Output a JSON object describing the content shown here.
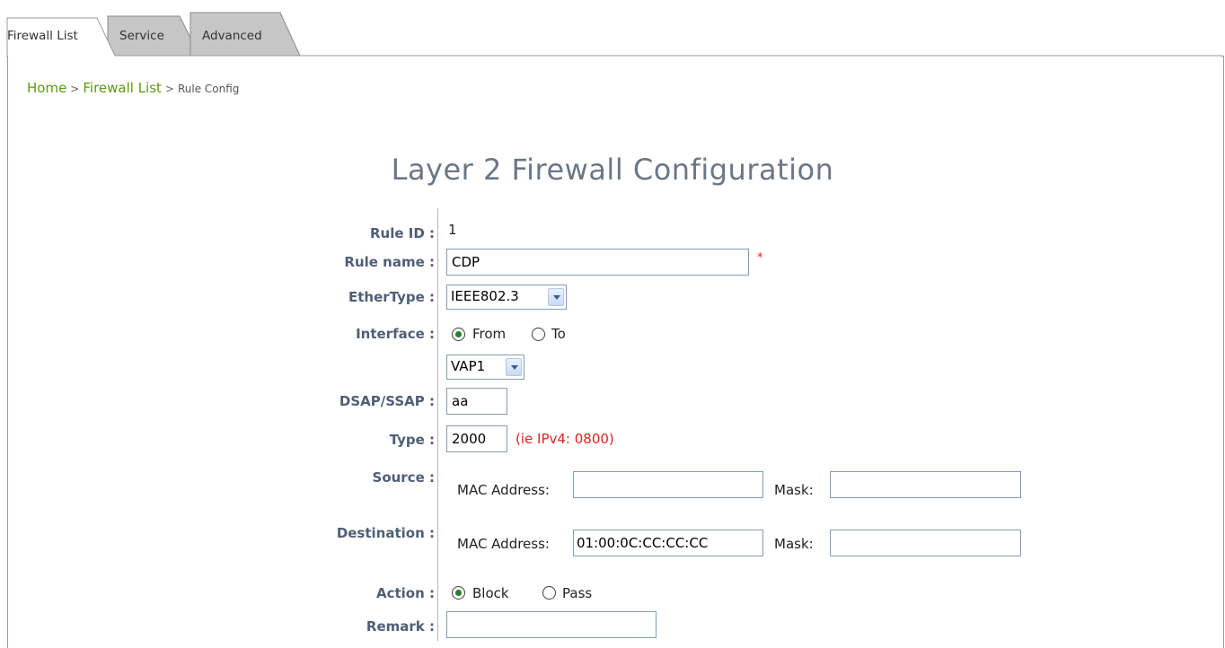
{
  "tabs": [
    {
      "label": "Firewall List",
      "active": true
    },
    {
      "label": "Service",
      "active": false
    },
    {
      "label": "Advanced",
      "active": false
    }
  ],
  "breadcrumb": {
    "home": "Home",
    "sep1": ">",
    "firewall_list": "Firewall List",
    "sep2": ">",
    "current": "Rule Config"
  },
  "page_title": "Layer 2 Firewall Configuration",
  "form": {
    "rule_id": {
      "label": "Rule ID :",
      "value": "1"
    },
    "rule_name": {
      "label": "Rule name :",
      "value": "CDP",
      "required_mark": "*"
    },
    "ethertype": {
      "label": "EtherType :",
      "selected": "IEEE802.3"
    },
    "interface": {
      "label": "Interface :",
      "from_label": "From",
      "to_label": "To",
      "selected_direction": "From",
      "selected": "VAP1"
    },
    "dsap_ssap": {
      "label": "DSAP/SSAP :",
      "value": "aa"
    },
    "type": {
      "label": "Type :",
      "value": "2000",
      "hint": "(ie IPv4: 0800)"
    },
    "source": {
      "label": "Source :",
      "mac_label": "MAC Address:",
      "mac_value": "",
      "mask_label": "Mask:",
      "mask_value": ""
    },
    "destination": {
      "label": "Destination :",
      "mac_label": "MAC Address:",
      "mac_value": "01:00:0C:CC:CC:CC",
      "mask_label": "Mask:",
      "mask_value": ""
    },
    "action": {
      "label": "Action :",
      "block_label": "Block",
      "pass_label": "Pass",
      "selected": "Block"
    },
    "remark": {
      "label": "Remark :",
      "value": ""
    }
  },
  "colors": {
    "link": "#5b9a15",
    "label": "#4e5f75",
    "title": "#6b7786",
    "hint": "#e52020"
  }
}
